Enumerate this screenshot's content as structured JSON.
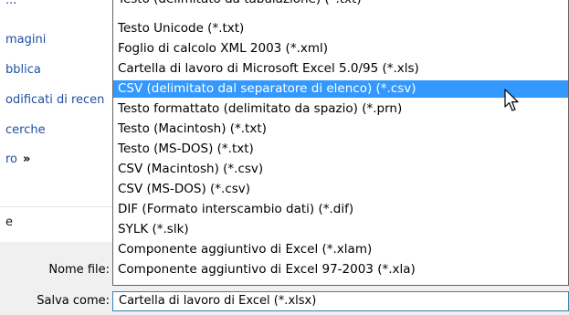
{
  "nav": {
    "items": [
      "magini",
      "bblica",
      "odificati di recen",
      "cerche",
      "ro"
    ],
    "more_glyph": "»",
    "bottom_item": "e"
  },
  "dropdown": {
    "partial_top": "Testo (delimitato da tabulazione) (*.txt)",
    "options": [
      "Testo Unicode (*.txt)",
      "Foglio di calcolo XML 2003 (*.xml)",
      "Cartella di lavoro di Microsoft Excel 5.0/95 (*.xls)",
      "CSV (delimitato dal separatore di elenco) (*.csv)",
      "Testo formattato (delimitato da spazio) (*.prn)",
      "Testo (Macintosh) (*.txt)",
      "Testo (MS-DOS) (*.txt)",
      "CSV (Macintosh) (*.csv)",
      "CSV (MS-DOS) (*.csv)",
      "DIF (Formato interscambio dati) (*.dif)",
      "SYLK (*.slk)",
      "Componente aggiuntivo di Excel (*.xlam)",
      "Componente aggiuntivo di Excel 97-2003 (*.xla)"
    ],
    "selected_index": 3
  },
  "form": {
    "filename_label": "Nome file:",
    "savetype_label": "Salva come:",
    "savetype_value": "Cartella di lavoro di Excel (*.xlsx)"
  },
  "colors": {
    "selection": "#3399ff",
    "link": "#1e4fa3",
    "form_bg": "#f0f0f0"
  },
  "icons": {
    "cursor": "arrow-cursor-icon",
    "more": "double-chevron-right-icon"
  }
}
